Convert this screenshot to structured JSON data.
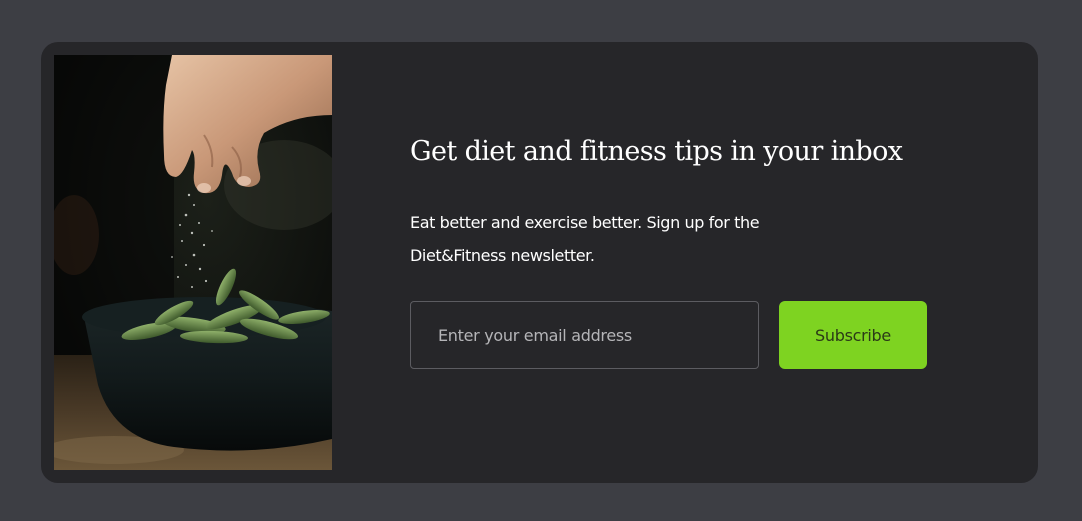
{
  "newsletter": {
    "image_alt": "Hand sprinkling salt over a bowl of edamame",
    "headline": "Get diet and fitness tips in your inbox",
    "description": "Eat better and exercise better. Sign up for the Diet&Fitness newsletter.",
    "email_placeholder": "Enter your email address",
    "email_value": "",
    "subscribe_label": "Subscribe"
  },
  "colors": {
    "page_background": "#3d3e44",
    "card_background": "#262629",
    "accent": "#7ed321",
    "text": "#ffffff"
  }
}
